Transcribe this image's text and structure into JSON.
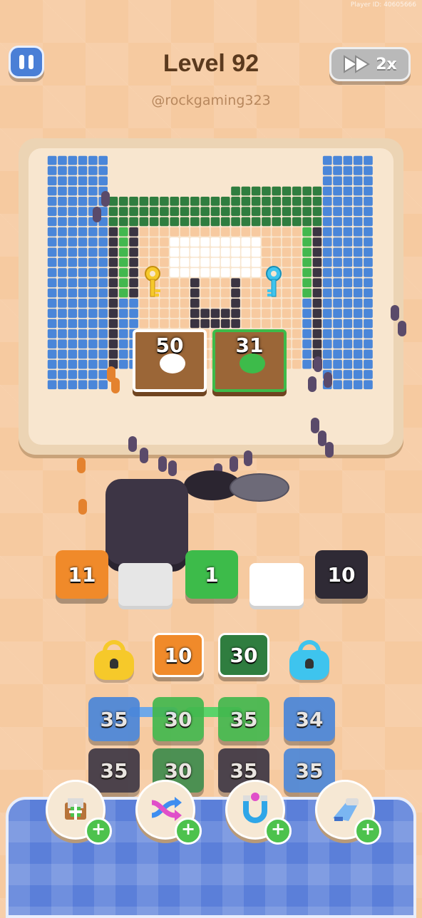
{
  "header": {
    "title": "Level 92",
    "handle": "@rockgaming323",
    "speed_label": "2x",
    "corner_id": "Player ID: 40605666"
  },
  "board": {
    "left_box_count": "50",
    "right_box_count": "31"
  },
  "queue_tiles": [
    {
      "label": "11",
      "color": "#f08a2a"
    },
    {
      "label": "",
      "color": "#ffffff"
    },
    {
      "label": "1",
      "color": "#3dbb4a"
    },
    {
      "label": "",
      "color": "#ffffff"
    },
    {
      "label": "10",
      "color": "#2f2a35"
    }
  ],
  "stack_rows": [
    [
      {
        "type": "lock",
        "color": "#f6c92a",
        "icon": "lock-yellow-icon"
      },
      {
        "label": "10",
        "color": "#f08a2a"
      },
      {
        "label": "30",
        "color": "#2f7d3f"
      },
      {
        "type": "lock",
        "color": "#3ec4ee",
        "icon": "lock-cyan-icon"
      }
    ],
    [
      {
        "label": "35",
        "color": "#4a86d9"
      },
      {
        "label": "30",
        "color": "#43b84e"
      },
      {
        "label": "35",
        "color": "#43b84e"
      },
      {
        "label": "34",
        "color": "#4a86d9"
      }
    ],
    [
      {
        "label": "35",
        "color": "#3a3442"
      },
      {
        "label": "30",
        "color": "#3a8a4a"
      },
      {
        "label": "35",
        "color": "#3a3442"
      },
      {
        "label": "35",
        "color": "#4a86d9"
      }
    ]
  ],
  "boosters": [
    {
      "name": "add-box-booster",
      "icon": "box-plus-icon"
    },
    {
      "name": "shuffle-booster",
      "icon": "shuffle-arrows-icon"
    },
    {
      "name": "magnet-booster",
      "icon": "magnet-icon"
    },
    {
      "name": "vacuum-booster",
      "icon": "vacuum-icon"
    }
  ],
  "colors": {
    "blue": "#4a86d9",
    "dark_green": "#2f7d3f",
    "green": "#43b84e",
    "dark": "#3a3442",
    "orange": "#f08a2a",
    "skin": "#f7caa0",
    "white": "#ffffff",
    "brown": "#5b3a1e"
  }
}
